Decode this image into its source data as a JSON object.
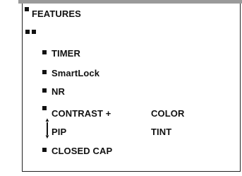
{
  "menu": {
    "title": "FEATURES",
    "items": [
      {
        "label": "TIMER"
      },
      {
        "label": "SmartLock"
      },
      {
        "label": "NR"
      },
      {
        "label": "CONTRAST +",
        "value": "COLOR"
      },
      {
        "label": "PIP",
        "value": "TINT"
      },
      {
        "label": "CLOSED CAP"
      }
    ]
  },
  "colors": {
    "text": "#111111",
    "background": "#ffffff",
    "top_bar": "#9a9a9a",
    "border": "#222222"
  },
  "icons": {
    "bullet": "filled-square",
    "scroll": "up-down-arrow"
  }
}
